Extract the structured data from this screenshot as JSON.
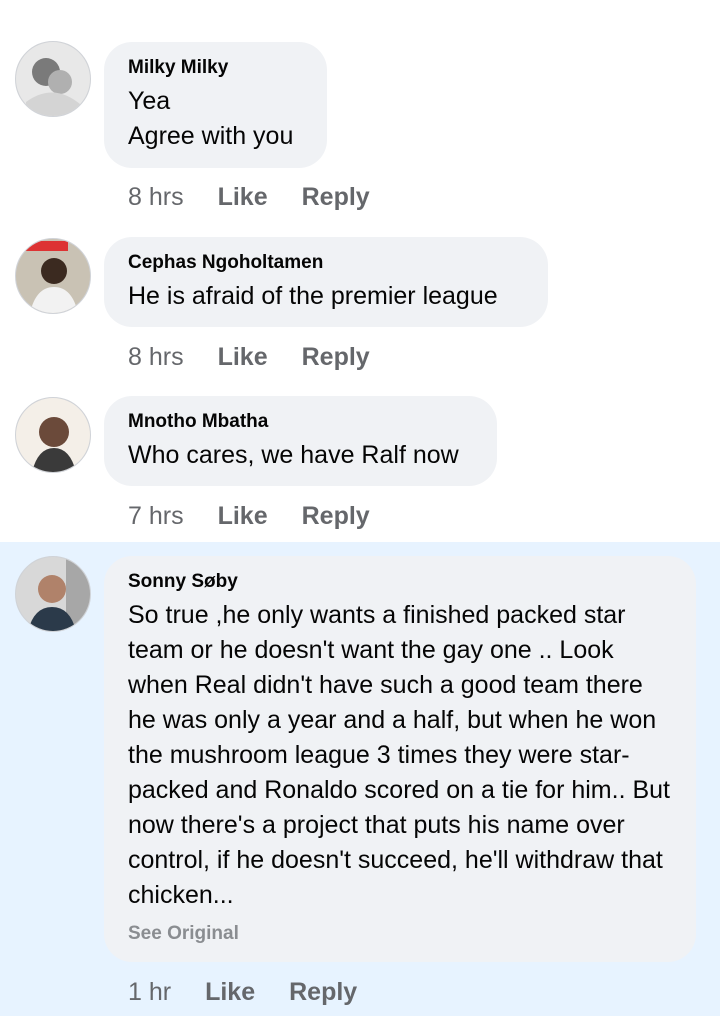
{
  "comments": [
    {
      "author": "Milky Milky",
      "text": "Yea\nAgree with you",
      "time": "8 hrs",
      "like_label": "Like",
      "reply_label": "Reply",
      "avatar": "avatar-photo-bw"
    },
    {
      "author": "Cephas Ngoholtamen",
      "text": "He is afraid of the premier league",
      "time": "8 hrs",
      "like_label": "Like",
      "reply_label": "Reply",
      "avatar": "avatar-photo-person"
    },
    {
      "author": "Mnotho Mbatha",
      "text": "Who cares, we have Ralf now",
      "time": "7 hrs",
      "like_label": "Like",
      "reply_label": "Reply",
      "avatar": "avatar-photo-person"
    },
    {
      "author": "Sonny Søby",
      "text": "So true ,he only wants a finished packed star team or he doesn't want the gay one .. Look when Real didn't have such a good team there he was only a year and a half, but when he won the mushroom league 3 times they were star-packed and Ronaldo scored on a tie for him.. But now there's a project that puts his name over control, if he doesn't succeed, he'll withdraw that chicken...",
      "see_original_label": "See Original",
      "time": "1 hr",
      "like_label": "Like",
      "reply_label": "Reply",
      "avatar": "avatar-photo-person"
    }
  ],
  "colors": {
    "bubble": "#f0f2f5",
    "highlight": "#e7f3ff",
    "meta_text": "#65676b",
    "see_original": "#8a8d91"
  }
}
